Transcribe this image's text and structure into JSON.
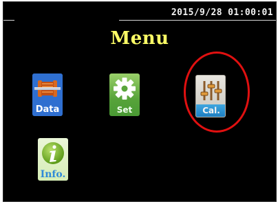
{
  "status": {
    "datetime": "2015/9/28 01:00:01"
  },
  "title": "Menu",
  "menu": [
    {
      "key": "data",
      "label": "Data",
      "icon": "data-spool-icon"
    },
    {
      "key": "set",
      "label": "Set",
      "icon": "gear-icon"
    },
    {
      "key": "cal",
      "label": "Cal.",
      "icon": "sliders-icon"
    },
    {
      "key": "info",
      "label": "Info.",
      "icon": "info-icon"
    }
  ],
  "annotation": {
    "highlight_target": "cal",
    "highlight_color": "#e01010"
  },
  "colors": {
    "background": "#000000",
    "title": "#ffff66",
    "datetime": "#f2f2f2"
  }
}
